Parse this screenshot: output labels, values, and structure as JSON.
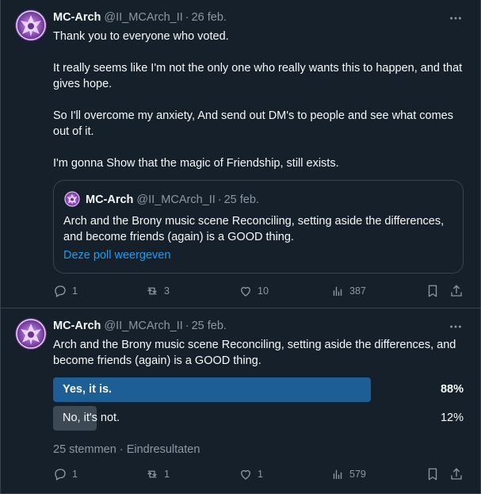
{
  "colors": {
    "background": "#15202b",
    "border": "#38444d",
    "text": "#f7f9f9",
    "muted": "#8b98a5",
    "link": "#1d9bf0",
    "poll_winner": "#1d5e94",
    "poll_loser": "#3d4a56"
  },
  "icons": {
    "reply": "reply-icon",
    "retweet": "retweet-icon",
    "like": "heart-icon",
    "views": "bar-chart-icon",
    "bookmark": "bookmark-icon",
    "share": "share-icon",
    "more": "more-icon"
  },
  "tweets": [
    {
      "author": {
        "name": "MC-Arch",
        "handle": "@II_MCArch_II",
        "separator": "·",
        "date": "26 feb."
      },
      "text": "Thank you to everyone who voted.\n\nIt really seems like I'm not the only one who really wants this to happen, and that gives hope.\n\nSo I'll overcome my anxiety, And send out DM's to people and see what comes out of it.\n\nI'm gonna Show that the magic of Friendship, still exists.",
      "quote": {
        "author": {
          "name": "MC-Arch",
          "handle": "@II_MCArch_II",
          "separator": "·",
          "date": "25 feb."
        },
        "text": "Arch and the Brony music scene Reconciling, setting aside the differences, and become friends (again) is a GOOD thing.",
        "link": "Deze poll weergeven"
      },
      "actions": {
        "replies": "1",
        "retweets": "3",
        "likes": "10",
        "views": "387"
      }
    },
    {
      "author": {
        "name": "MC-Arch",
        "handle": "@II_MCArch_II",
        "separator": "·",
        "date": "25 feb."
      },
      "text": "Arch and the Brony music scene Reconciling, setting aside the differences, and become friends (again) is a GOOD thing.",
      "poll": {
        "options": [
          {
            "label": "Yes, it is.",
            "percent": "88%",
            "value": 0.88,
            "winner": true
          },
          {
            "label": "No, it's not.",
            "percent": "12%",
            "value": 0.12,
            "winner": false
          }
        ],
        "votes": "25 stemmen",
        "separator": "·",
        "status": "Eindresultaten"
      },
      "actions": {
        "replies": "1",
        "retweets": "1",
        "likes": "1",
        "views": "579"
      }
    }
  ]
}
